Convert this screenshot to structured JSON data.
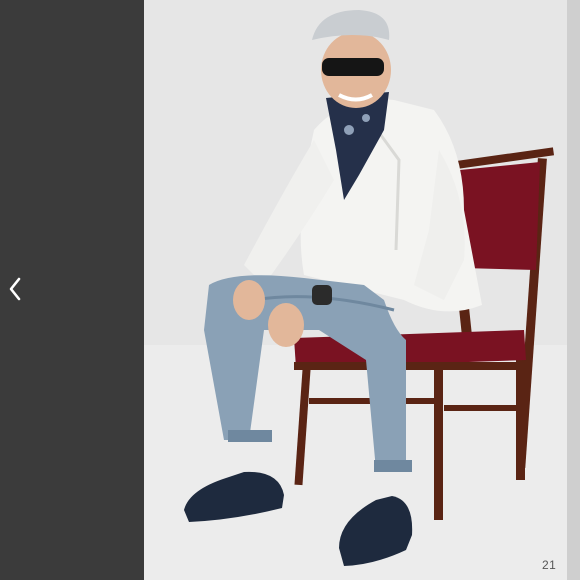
{
  "viewer": {
    "prev_icon": "chevron-left-icon",
    "page_number": "21"
  },
  "colors": {
    "left_panel": "#3b3b3b",
    "backdrop": "#e4e4e4",
    "chair_seat": "#7a1222"
  }
}
